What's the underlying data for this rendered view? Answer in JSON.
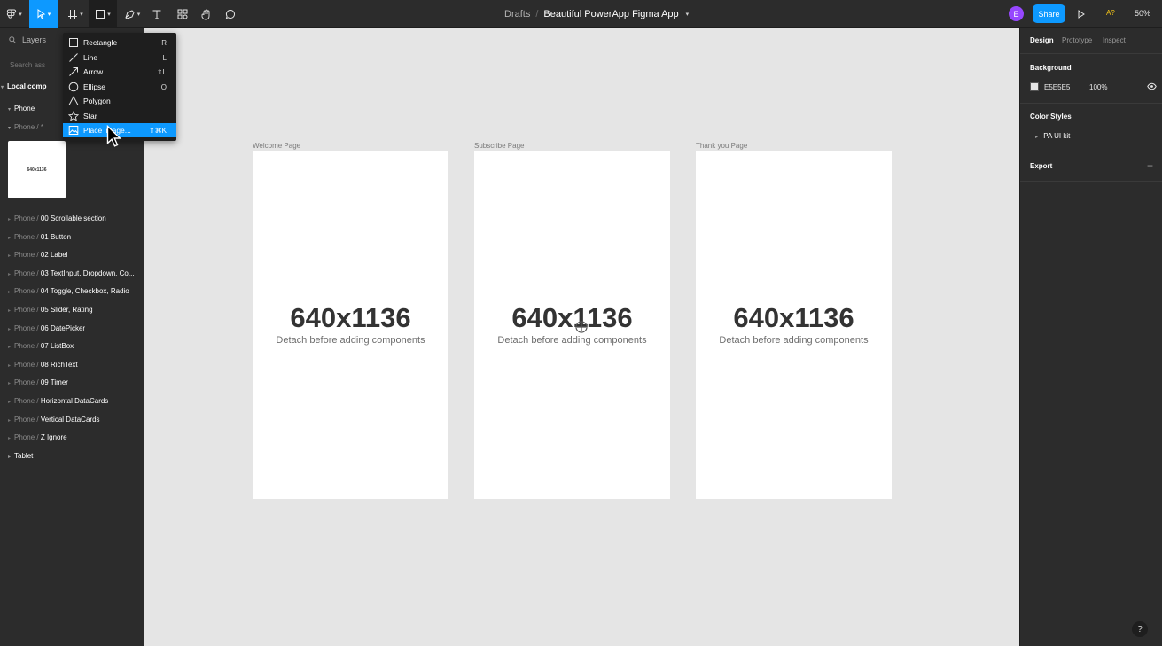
{
  "toolbar": {
    "breadcrumb": "Drafts",
    "separator": "/",
    "file_title": "Beautiful PowerApp Figma App",
    "avatar_initial": "E",
    "share_label": "Share",
    "font_warning": "A?",
    "zoom": "50%"
  },
  "left_panel": {
    "tab_layers": "Layers",
    "search_placeholder": "Search ass",
    "local_components": "Local comp",
    "group_phone": "Phone",
    "subgroup_prefix": "Phone / *",
    "thumb_label": "640x1136",
    "layers": [
      {
        "prefix": "Phone / ",
        "name": "00 Scrollable section"
      },
      {
        "prefix": "Phone / ",
        "name": "01 Button"
      },
      {
        "prefix": "Phone / ",
        "name": "02 Label"
      },
      {
        "prefix": "Phone / ",
        "name": "03 TextInput, Dropdown, Co..."
      },
      {
        "prefix": "Phone / ",
        "name": "04 Toggle, Checkbox, Radio"
      },
      {
        "prefix": "Phone / ",
        "name": "05 Slider, Rating"
      },
      {
        "prefix": "Phone / ",
        "name": "06 DatePicker"
      },
      {
        "prefix": "Phone / ",
        "name": "07 ListBox"
      },
      {
        "prefix": "Phone / ",
        "name": "08 RichText"
      },
      {
        "prefix": "Phone / ",
        "name": "09 Timer"
      },
      {
        "prefix": "Phone / ",
        "name": "Horizontal DataCards"
      },
      {
        "prefix": "Phone / ",
        "name": "Vertical DataCards"
      },
      {
        "prefix": "Phone / ",
        "name": "Z Ignore"
      }
    ],
    "group_tablet": "Tablet"
  },
  "shape_menu": {
    "items": [
      {
        "label": "Rectangle",
        "shortcut": "R",
        "icon": "rectangle-icon"
      },
      {
        "label": "Line",
        "shortcut": "L",
        "icon": "line-icon"
      },
      {
        "label": "Arrow",
        "shortcut": "⇧L",
        "icon": "arrow-icon"
      },
      {
        "label": "Ellipse",
        "shortcut": "O",
        "icon": "ellipse-icon"
      },
      {
        "label": "Polygon",
        "shortcut": "",
        "icon": "polygon-icon"
      },
      {
        "label": "Star",
        "shortcut": "",
        "icon": "star-icon"
      },
      {
        "label": "Place image...",
        "shortcut": "⇧⌘K",
        "icon": "image-icon",
        "highlighted": true
      }
    ]
  },
  "canvas": {
    "frames": [
      {
        "label": "Welcome Page",
        "size": "640x1136",
        "subtitle": "Detach before adding components"
      },
      {
        "label": "Subscribe Page",
        "size": "640x1136",
        "subtitle": "Detach before adding components"
      },
      {
        "label": "Thank you Page",
        "size": "640x1136",
        "subtitle": "Detach before adding components"
      }
    ]
  },
  "right_panel": {
    "tabs": [
      "Design",
      "Prototype",
      "Inspect"
    ],
    "background_title": "Background",
    "background_hex": "E5E5E5",
    "background_opacity": "100%",
    "color_styles_title": "Color Styles",
    "color_style_item": "PA UI kit",
    "export_title": "Export",
    "help": "?"
  },
  "colors": {
    "accent": "#0d99ff",
    "panel": "#2c2c2c",
    "canvas": "#e5e5e5"
  }
}
